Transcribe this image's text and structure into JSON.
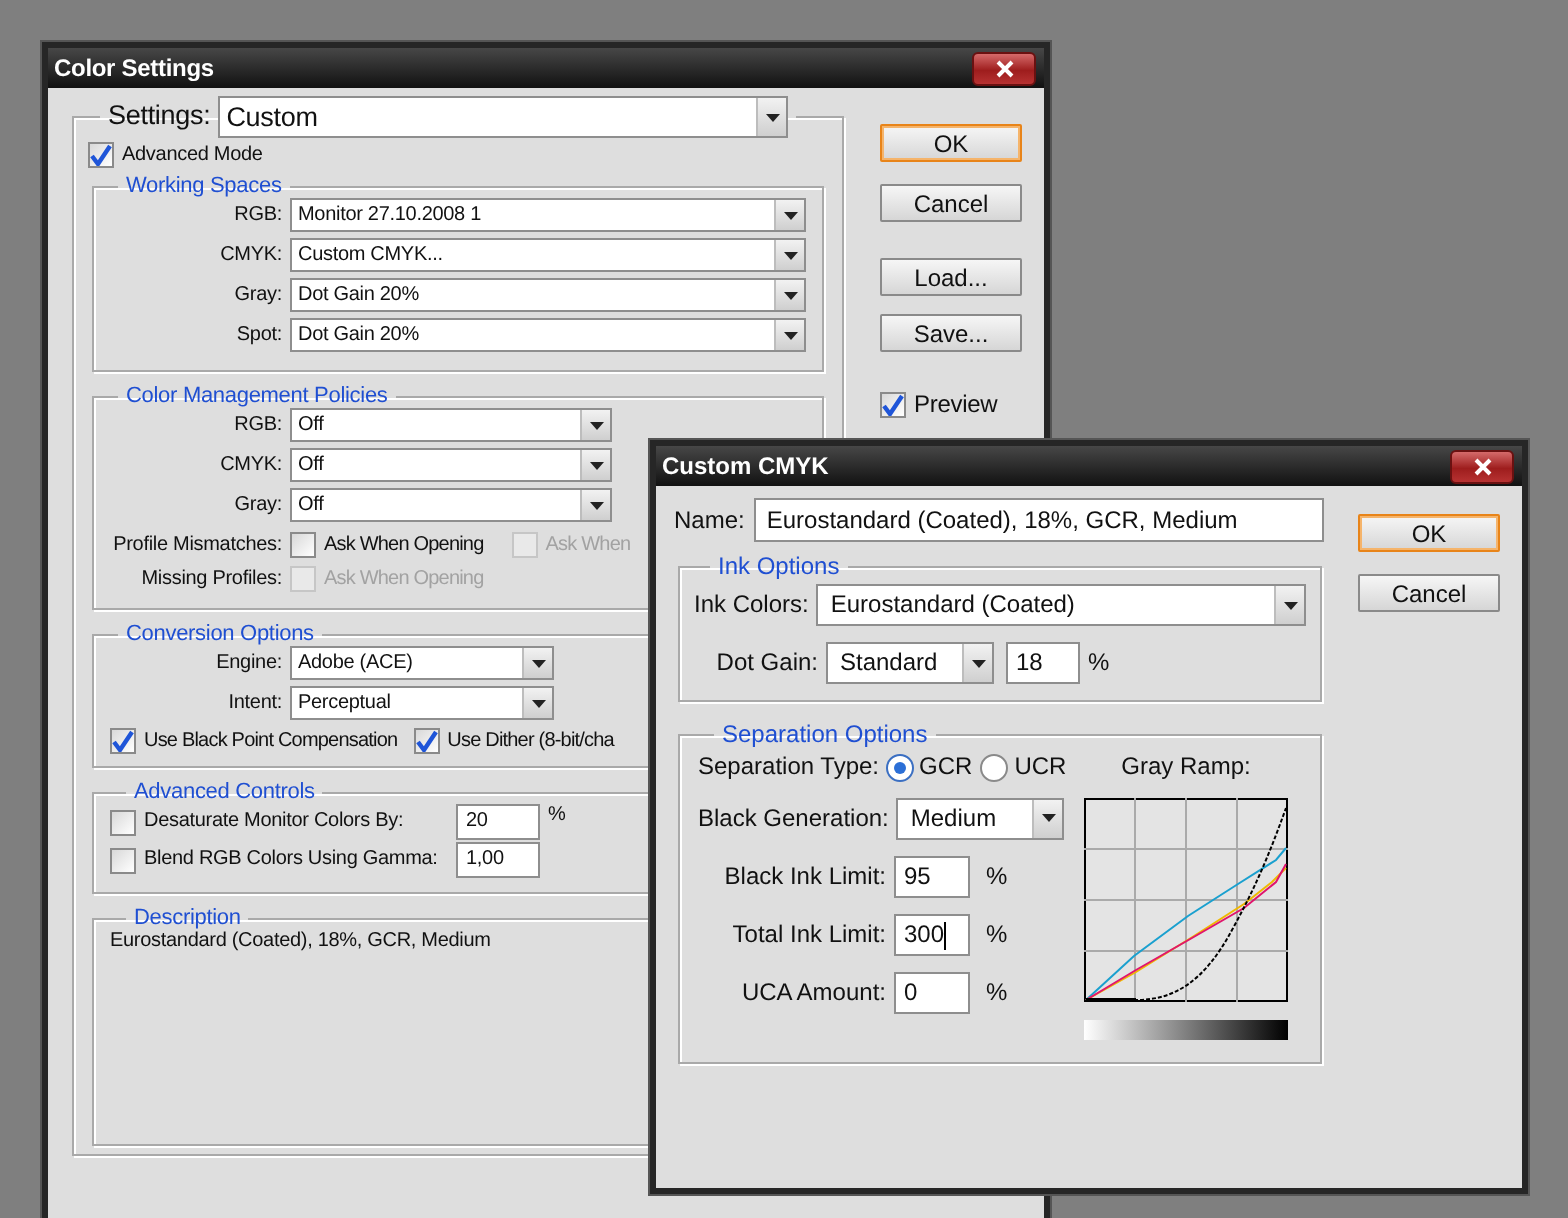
{
  "color_settings": {
    "title": "Color Settings",
    "settings": {
      "label": "Settings:",
      "value": "Custom"
    },
    "advanced_mode": {
      "label": "Advanced Mode",
      "checked": true
    },
    "working_spaces": {
      "title": "Working Spaces",
      "rows": [
        {
          "label": "RGB:",
          "value": "Monitor  27.10.2008  1"
        },
        {
          "label": "CMYK:",
          "value": "Custom CMYK..."
        },
        {
          "label": "Gray:",
          "value": "Dot Gain 20%"
        },
        {
          "label": "Spot:",
          "value": "Dot Gain 20%"
        }
      ]
    },
    "policies": {
      "title": "Color Management Policies",
      "rows": [
        {
          "label": "RGB:",
          "value": "Off"
        },
        {
          "label": "CMYK:",
          "value": "Off"
        },
        {
          "label": "Gray:",
          "value": "Off"
        }
      ],
      "check_rows": [
        {
          "label": "Profile Mismatches:",
          "options": [
            {
              "label": "Ask When Opening",
              "checked": false,
              "disabled": false
            },
            {
              "label": "Ask When",
              "checked": false,
              "disabled": true
            }
          ]
        },
        {
          "label": "Missing Profiles:",
          "options": [
            {
              "label": "Ask When Opening",
              "checked": false,
              "disabled": true
            }
          ]
        }
      ]
    },
    "conversion": {
      "title": "Conversion Options",
      "rows": [
        {
          "label": "Engine:",
          "value": "Adobe (ACE)"
        },
        {
          "label": "Intent:",
          "value": "Perceptual"
        }
      ],
      "checks": [
        {
          "label": "Use Black Point Compensation",
          "checked": true
        },
        {
          "label": "Use Dither (8-bit/cha",
          "checked": true
        }
      ]
    },
    "advanced_controls": {
      "title": "Advanced Controls",
      "rows": [
        {
          "label": "Desaturate Monitor Colors By:",
          "checked": false,
          "value": "20",
          "unit": "%"
        },
        {
          "label": "Blend RGB Colors Using Gamma:",
          "checked": false,
          "value": "1,00"
        }
      ]
    },
    "description": {
      "title": "Description",
      "text": "Eurostandard (Coated), 18%, GCR, Medium"
    },
    "buttons": [
      {
        "label": "OK",
        "default": true
      },
      {
        "label": "Cancel",
        "default": false
      }
    ],
    "file_buttons": [
      {
        "label": "Load...",
        "default": false
      },
      {
        "label": "Save...",
        "default": false
      }
    ],
    "preview": {
      "label": "Preview",
      "checked": true
    }
  },
  "custom_cmyk": {
    "title": "Custom CMYK",
    "name": {
      "label": "Name:",
      "value": "Eurostandard (Coated), 18%, GCR, Medium"
    },
    "buttons": [
      {
        "label": "OK",
        "default": true
      },
      {
        "label": "Cancel",
        "default": false
      }
    ],
    "ink_options": {
      "title": "Ink Options",
      "ink_colors": {
        "label": "Ink Colors:",
        "value": "Eurostandard (Coated)"
      },
      "dot_gain": {
        "label": "Dot Gain:",
        "value": "Standard",
        "amount": "18",
        "unit": "%"
      }
    },
    "separation": {
      "title": "Separation Options",
      "type": {
        "label": "Separation Type:",
        "options": [
          {
            "label": "GCR",
            "selected": true
          },
          {
            "label": "UCR",
            "selected": false
          }
        ]
      },
      "black_generation": {
        "label": "Black Generation:",
        "value": "Medium"
      },
      "limits": [
        {
          "label": "Black Ink Limit:",
          "value": "95",
          "unit": "%",
          "focused": false
        },
        {
          "label": "Total Ink Limit:",
          "value": "300",
          "unit": "%",
          "focused": true
        },
        {
          "label": "UCA Amount:",
          "value": "0",
          "unit": "%",
          "focused": false
        }
      ],
      "gray_ramp": {
        "title": "Gray Ramp:"
      }
    }
  }
}
